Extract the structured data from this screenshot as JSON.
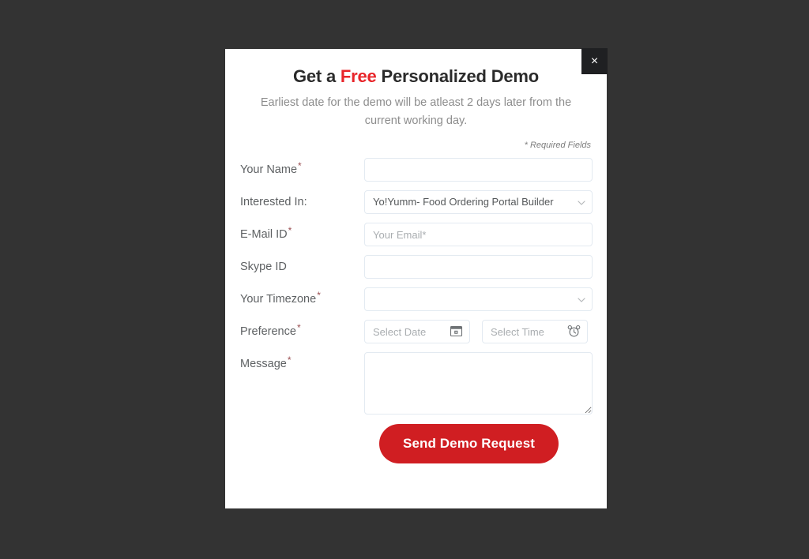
{
  "page": {
    "background_color": "#333333",
    "accent_red": "#e8252a",
    "button_red": "#d01e22"
  },
  "modal": {
    "close_label": "×",
    "title_part1": "Get a ",
    "title_accent": "Free",
    "title_part2": " Personalized Demo",
    "subtitle": "Earliest date for the demo will be atleast 2 days later from the current working day.",
    "required_note": "* Required Fields"
  },
  "form": {
    "fields": [
      {
        "label": "Your Name",
        "required": true,
        "type": "text",
        "value": "",
        "placeholder": ""
      },
      {
        "label": "Interested In:",
        "required": false,
        "type": "select",
        "value": "Yo!Yumm- Food Ordering Portal Builder",
        "placeholder": ""
      },
      {
        "label": "E-Mail ID",
        "required": true,
        "type": "text",
        "value": "",
        "placeholder": "Your Email*"
      },
      {
        "label": "Skype ID",
        "required": false,
        "type": "text",
        "value": "",
        "placeholder": ""
      },
      {
        "label": "Your Timezone",
        "required": true,
        "type": "select",
        "value": "",
        "placeholder": ""
      },
      {
        "label": "Preference",
        "required": true,
        "type": "datetime",
        "date_placeholder": "Select Date",
        "date_value": "",
        "time_placeholder": "Select Time",
        "time_value": ""
      },
      {
        "label": "Message",
        "required": true,
        "type": "textarea",
        "value": "",
        "placeholder": ""
      }
    ],
    "required_marker": "*",
    "submit_label": "Send Demo Request"
  }
}
